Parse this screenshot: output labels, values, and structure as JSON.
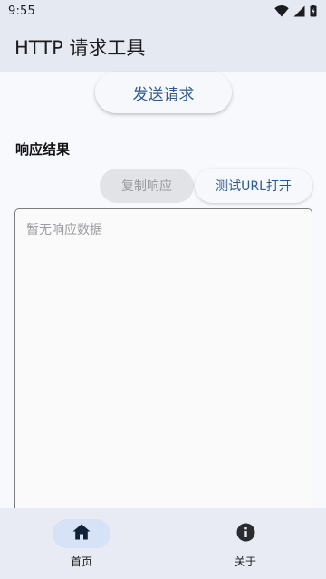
{
  "status_bar": {
    "time": "9:55",
    "icons": [
      "wifi-icon",
      "signal-icon",
      "battery-icon"
    ]
  },
  "app_bar": {
    "title": "HTTP 请求工具"
  },
  "main": {
    "send_button_label": "发送请求",
    "response_section_label": "响应结果",
    "copy_button_label": "复制响应",
    "test_url_button_label": "测试URL打开",
    "response_placeholder": "暂无响应数据"
  },
  "bottom_nav": {
    "items": [
      {
        "label": "首页",
        "icon": "home-icon",
        "selected": true
      },
      {
        "label": "关于",
        "icon": "info-icon",
        "selected": false
      }
    ]
  },
  "colors": {
    "app_bar_bg": "#e5e9f2",
    "accent_text": "#2d5b8a",
    "nav_selected_pill": "#d6e2f5"
  }
}
